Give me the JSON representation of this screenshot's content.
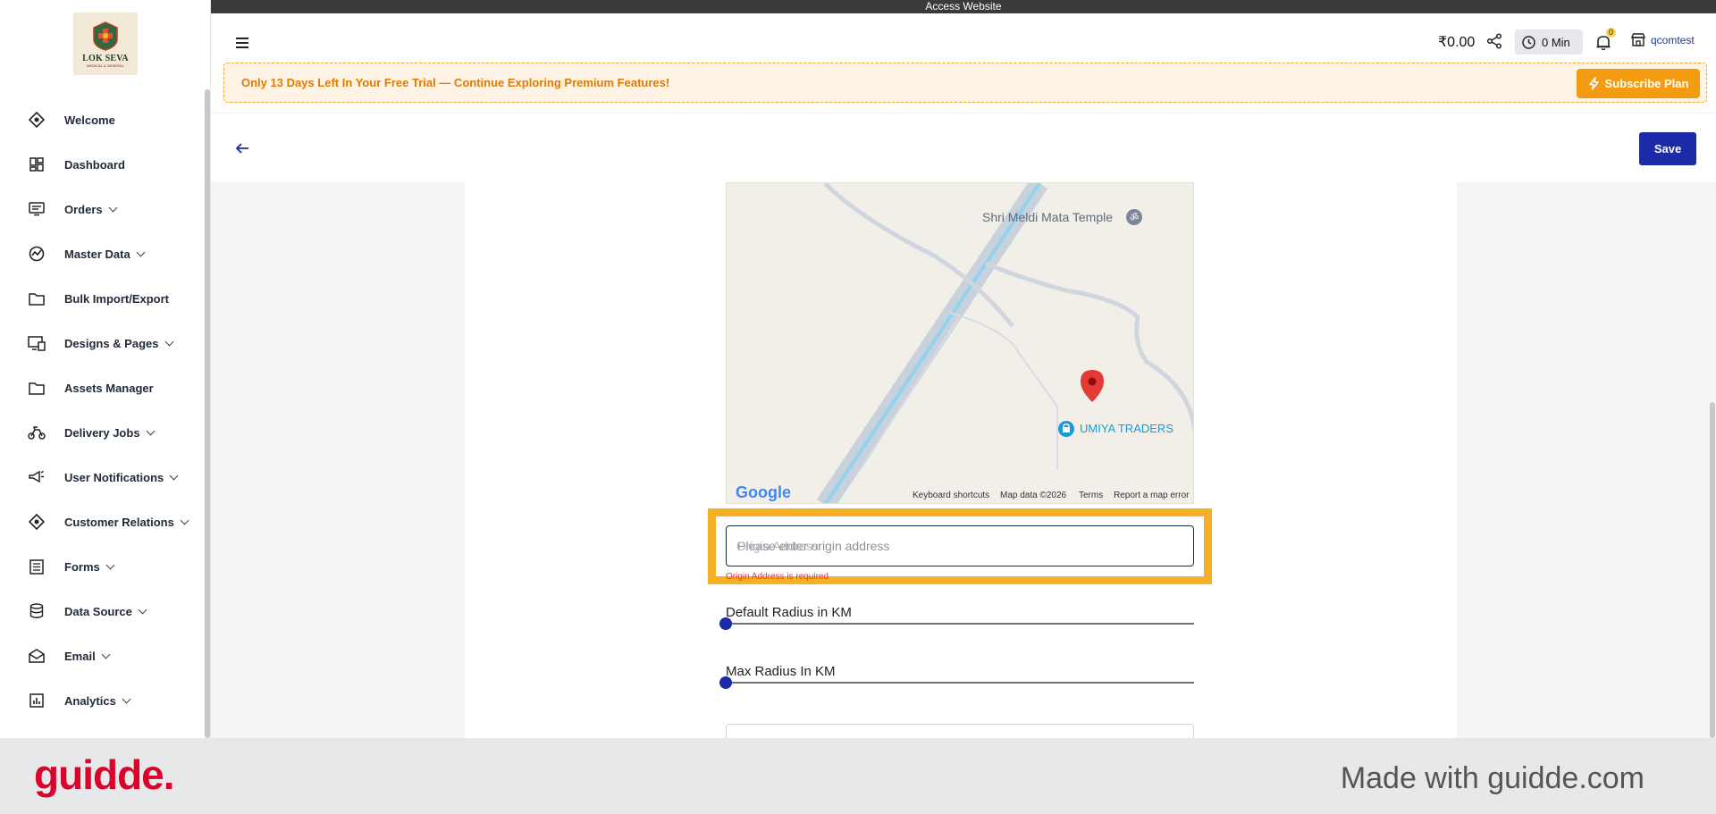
{
  "access_bar": {
    "text": "Access Website"
  },
  "logo": {
    "brand": "LOK SEVA",
    "tagline": "MEDICAL & GENERAL"
  },
  "sidebar": {
    "items": [
      {
        "label": "Welcome",
        "icon": "welcome-icon",
        "has_submenu": false
      },
      {
        "label": "Dashboard",
        "icon": "dashboard-icon",
        "has_submenu": false
      },
      {
        "label": "Orders",
        "icon": "orders-icon",
        "has_submenu": true
      },
      {
        "label": "Master Data",
        "icon": "master-data-icon",
        "has_submenu": true
      },
      {
        "label": "Bulk Import/Export",
        "icon": "folder-icon",
        "has_submenu": false
      },
      {
        "label": "Designs & Pages",
        "icon": "designs-icon",
        "has_submenu": true
      },
      {
        "label": "Assets Manager",
        "icon": "folder-icon",
        "has_submenu": false
      },
      {
        "label": "Delivery Jobs",
        "icon": "delivery-icon",
        "has_submenu": true
      },
      {
        "label": "User Notifications",
        "icon": "megaphone-icon",
        "has_submenu": true
      },
      {
        "label": "Customer Relations",
        "icon": "customer-relations-icon",
        "has_submenu": true
      },
      {
        "label": "Forms",
        "icon": "forms-icon",
        "has_submenu": true
      },
      {
        "label": "Data Source",
        "icon": "database-icon",
        "has_submenu": true
      },
      {
        "label": "Email",
        "icon": "email-icon",
        "has_submenu": true
      },
      {
        "label": "Analytics",
        "icon": "analytics-icon",
        "has_submenu": true
      }
    ]
  },
  "header": {
    "balance": "₹0.00",
    "timer": "0 Min",
    "notification_count": "0",
    "store_name": "qcomtest",
    "trial_message": "Only 13 Days Left In Your Free Trial — Continue Exploring Premium Features!",
    "subscribe_label": "Subscribe Plan"
  },
  "toolbar": {
    "save_label": "Save"
  },
  "map": {
    "place_1": "Shri Meldi Mata Temple",
    "place_2": "UMIYA TRADERS",
    "provider": "Google",
    "footer": {
      "shortcuts": "Keyboard shortcuts",
      "data": "Map data ©2026",
      "terms": "Terms",
      "report": "Report a map error"
    }
  },
  "form": {
    "origin_label": "Origin Address",
    "origin_placeholder": "Please enter origin address",
    "origin_error": "Origin Address is required",
    "default_radius_label": "Default Radius in KM",
    "default_radius_value": 0,
    "max_radius_label": "Max Radius In KM",
    "max_radius_value": 0
  },
  "footer": {
    "logo": "guidde.",
    "made_with": "Made with guidde.com"
  },
  "colors": {
    "primary": "#1b2aa6",
    "accent": "#f39c12",
    "highlight": "#f7b026",
    "error": "#e53935"
  }
}
